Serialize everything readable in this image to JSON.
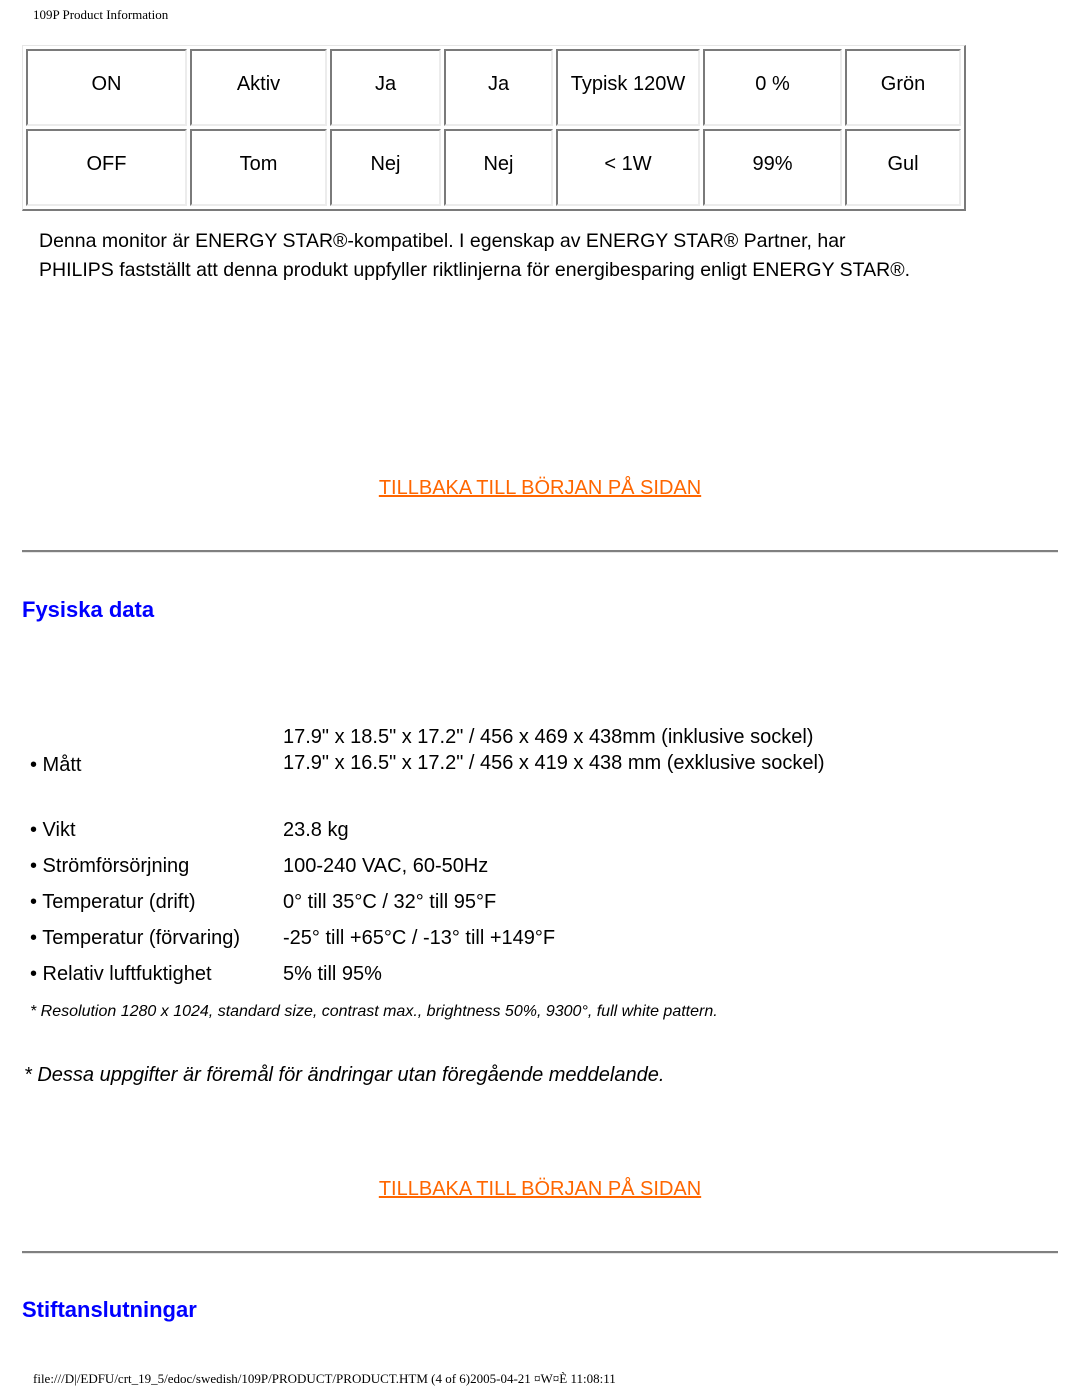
{
  "header": {
    "title": "109P Product Information"
  },
  "power_table": {
    "rows": [
      [
        "ON",
        "Aktiv",
        "Ja",
        "Ja",
        "Typisk 120W",
        "0 %",
        "Grön"
      ],
      [
        "OFF",
        "Tom",
        "Nej",
        "Nej",
        "< 1W",
        "99%",
        "Gul"
      ]
    ]
  },
  "energy_star": {
    "line1": "Denna monitor är ENERGY STAR®-kompatibel. I egenskap av ENERGY STAR® Partner, har",
    "line2": "PHILIPS fastställt att denna produkt uppfyller riktlinjerna för energibesparing enligt ENERGY STAR®."
  },
  "back_to_top_label": "TILLBAKA TILL BÖRJAN PÅ SIDAN",
  "physical": {
    "heading": "Fysiska data",
    "specs": [
      {
        "label": "• Mått",
        "values": [
          "17.9\" x 18.5\" x 17.2\" / 456 x 469 x 438mm (inklusive sockel)",
          "17.9\" x 16.5\" x 17.2\" / 456 x 419 x 438 mm (exklusive sockel)"
        ]
      },
      {
        "label": "• Vikt",
        "value": "23.8 kg"
      },
      {
        "label": "• Strömförsörjning",
        "value": "100-240 VAC, 60-50Hz"
      },
      {
        "label": "• Temperatur (drift)",
        "value": "0° till 35°C / 32° till 95°F"
      },
      {
        "label": "• Temperatur (förvaring)",
        "value": "-25° till +65°C / -13° till +149°F"
      },
      {
        "label": "• Relativ luftfuktighet",
        "value": "5% till 95%"
      }
    ],
    "footnote": "* Resolution 1280 x 1024, standard size, contrast max., brightness 50%, 9300°, full white pattern.",
    "notice": "* Dessa uppgifter är föremål för ändringar utan föregående meddelande."
  },
  "pin_section": {
    "heading": "Stiftanslutningar"
  },
  "footer": {
    "path": "file:///D|/EDFU/crt_19_5/edoc/swedish/109P/PRODUCT/PRODUCT.HTM (4 of 6)2005-04-21 ¤W¤È 11:08:11"
  }
}
